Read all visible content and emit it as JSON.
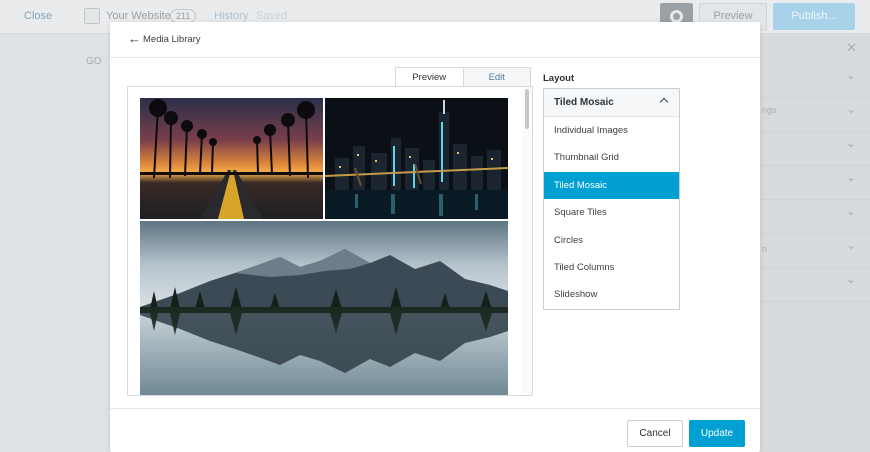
{
  "background": {
    "close_label": "Close",
    "site_name": "Your Website",
    "site_count": "211",
    "history_label": "History",
    "saved_label": "Saved",
    "preview_label": "Preview",
    "publish_label": "Publish...",
    "go_label": "GO",
    "fragment_1": "ngs",
    "fragment_2": "n"
  },
  "modal": {
    "back_label": "Media Library",
    "tabs": [
      {
        "label": "Preview",
        "active": true
      },
      {
        "label": "Edit",
        "active": false
      }
    ],
    "images": [
      {
        "name": "palm-road-sunset"
      },
      {
        "name": "city-skyline-night"
      },
      {
        "name": "mountain-lake-reflection"
      }
    ],
    "layout_label": "Layout",
    "layout_selected": "Tiled Mosaic",
    "layout_options": [
      "Individual Images",
      "Thumbnail Grid",
      "Tiled Mosaic",
      "Square Tiles",
      "Circles",
      "Tiled Columns",
      "Slideshow"
    ],
    "cancel_label": "Cancel",
    "update_label": "Update"
  },
  "colors": {
    "accent": "#00a0d2",
    "link": "#4f7fa0"
  }
}
